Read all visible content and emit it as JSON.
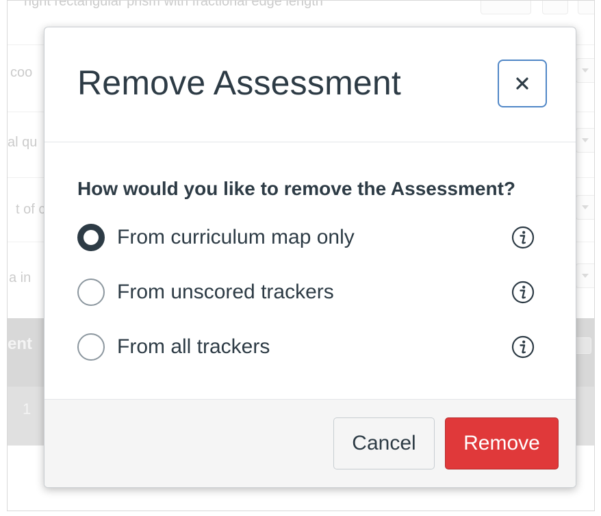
{
  "background": {
    "rows": [
      {
        "text": "right rectangular prism with fractional edge length"
      },
      {
        "text": "coo"
      },
      {
        "text": "al qu"
      },
      {
        "text": "t of c"
      },
      {
        "text": "a in"
      }
    ],
    "section_header": "ent",
    "row_value": "1"
  },
  "modal": {
    "title": "Remove Assessment",
    "close_label": "×",
    "question": "How would you like to remove the Assessment?",
    "options": [
      {
        "label": "From curriculum map only",
        "checked": true
      },
      {
        "label": "From unscored trackers",
        "checked": false
      },
      {
        "label": "From all trackers",
        "checked": false
      }
    ],
    "cancel_label": "Cancel",
    "remove_label": "Remove"
  },
  "colors": {
    "text": "#2d3b45",
    "focus_border": "#4f86c6",
    "danger": "#e0393a",
    "footer_bg": "#f5f5f5"
  },
  "icons": {
    "close": "close-icon",
    "info": "info-icon",
    "dropdown": "chevron-down-icon",
    "menu": "menu-icon"
  }
}
